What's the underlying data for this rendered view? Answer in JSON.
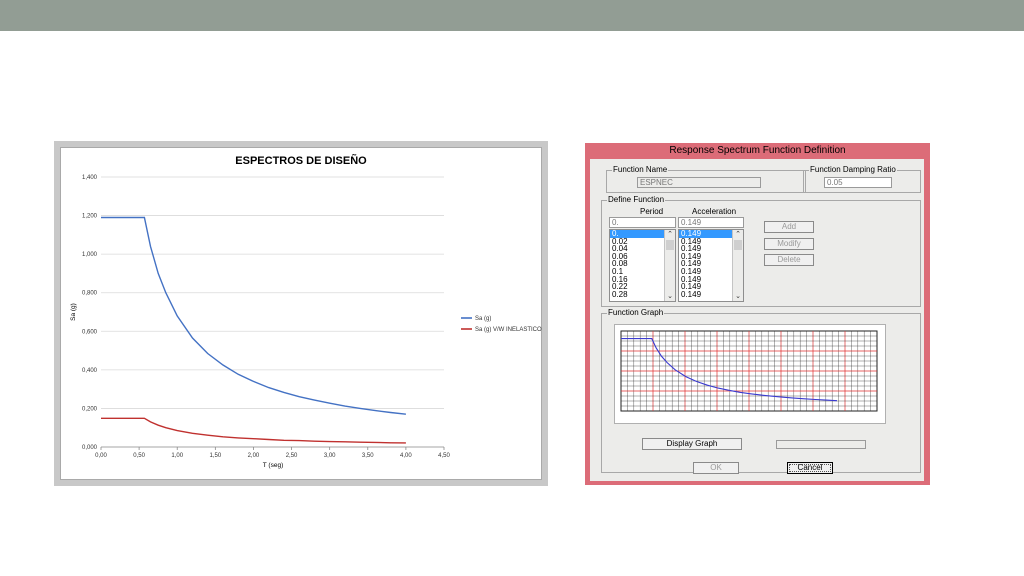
{
  "colors": {
    "topbar": "#929d94",
    "dialog_border": "#dc6c78",
    "series1": "#4472c4",
    "series2": "#c0312f",
    "grid_red": "#e03030",
    "grid_black": "#222222",
    "graph_curve": "#3a3ad0"
  },
  "chart_data": {
    "type": "line",
    "title": "ESPECTROS DE DISEÑO",
    "xlabel": "T (seg)",
    "ylabel": "Sa (g)",
    "xlim": [
      0,
      4.5
    ],
    "ylim": [
      0,
      1.4
    ],
    "x_ticks": [
      "0,00",
      "0,50",
      "1,00",
      "1,50",
      "2,00",
      "2,50",
      "3,00",
      "3,50",
      "4,00",
      "4,50"
    ],
    "y_ticks": [
      "0,000",
      "0,200",
      "0,400",
      "0,600",
      "0,800",
      "1,000",
      "1,200",
      "1,400"
    ],
    "grid": "horizontal",
    "legend_position": "right",
    "series": [
      {
        "name": "Sa (g)",
        "x": [
          0,
          0.3,
          0.57,
          0.65,
          0.75,
          0.85,
          1.0,
          1.2,
          1.4,
          1.6,
          1.8,
          2.0,
          2.2,
          2.4,
          2.6,
          2.8,
          3.0,
          3.2,
          3.4,
          3.6,
          3.8,
          4.0
        ],
        "y": [
          1.19,
          1.19,
          1.19,
          1.04,
          0.9,
          0.8,
          0.68,
          0.565,
          0.485,
          0.425,
          0.377,
          0.34,
          0.308,
          0.283,
          0.261,
          0.243,
          0.227,
          0.212,
          0.2,
          0.189,
          0.179,
          0.17
        ]
      },
      {
        "name": "Sa (g) V/W INELASTICO",
        "x": [
          0,
          0.3,
          0.57,
          0.65,
          0.75,
          0.85,
          1.0,
          1.2,
          1.4,
          1.6,
          1.8,
          2.0,
          2.2,
          2.4,
          2.6,
          2.8,
          3.0,
          3.2,
          3.4,
          3.6,
          3.8,
          4.0
        ],
        "y": [
          0.149,
          0.149,
          0.149,
          0.13,
          0.113,
          0.1,
          0.085,
          0.071,
          0.061,
          0.053,
          0.047,
          0.043,
          0.039,
          0.035,
          0.033,
          0.03,
          0.028,
          0.027,
          0.025,
          0.024,
          0.022,
          0.021
        ]
      }
    ]
  },
  "dialog": {
    "title": "Response Spectrum  Function Definition",
    "function_name_label": "Function Name",
    "function_name_value": "ESPNEC",
    "damping_label": "Function Damping Ratio",
    "damping_value": "0.05",
    "define_label": "Define Function",
    "period_header": "Period",
    "acceleration_header": "Acceleration",
    "period_input": "0.",
    "acceleration_input": "0.149",
    "periods": [
      "0.",
      "0.02",
      "0.04",
      "0.06",
      "0.08",
      "0.1",
      "0.16",
      "0.22",
      "0.28"
    ],
    "accelerations": [
      "0.149",
      "0.149",
      "0.149",
      "0.149",
      "0.149",
      "0.149",
      "0.149",
      "0.149",
      "0.149"
    ],
    "add_label": "Add",
    "modify_label": "Modify",
    "delete_label": "Delete",
    "graph_label": "Function Graph",
    "display_graph_label": "Display Graph",
    "ok_label": "OK",
    "cancel_label": "Cancel",
    "scroll_up_glyph": "⌃",
    "scroll_down_glyph": "⌄"
  }
}
